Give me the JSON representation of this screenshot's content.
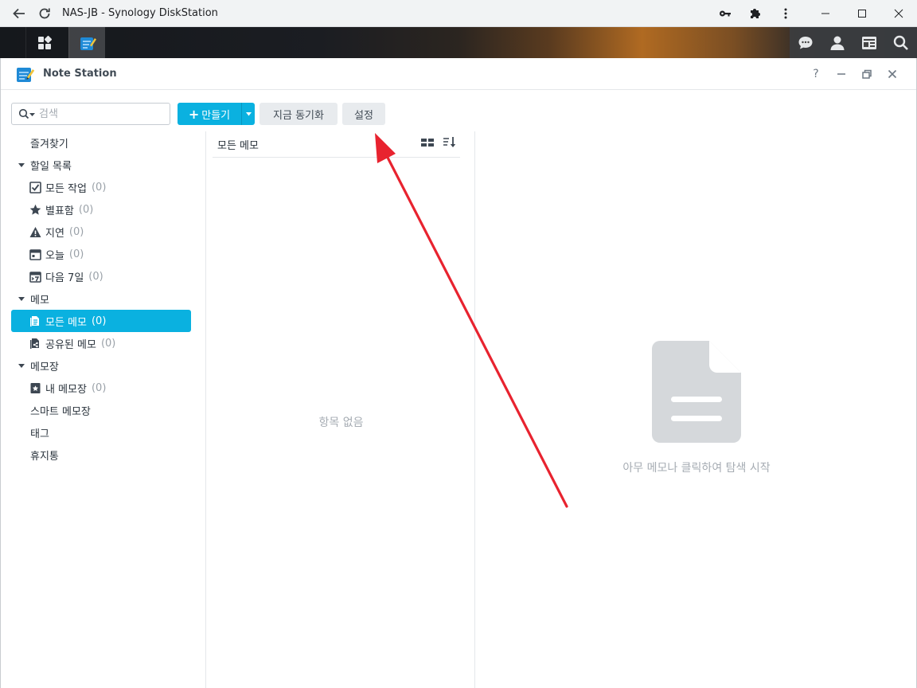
{
  "browser": {
    "title": "NAS-JB - Synology DiskStation"
  },
  "app": {
    "title": "Note Station",
    "help_label": "?"
  },
  "toolbar": {
    "search_placeholder": "검색",
    "create_label": "만들기",
    "sync_label": "지금 동기화",
    "settings_label": "설정"
  },
  "sidebar": {
    "favorites": "즐겨찾기",
    "todo_group": "할일 목록",
    "todo_items": [
      {
        "label": "모든 작업",
        "count": "(0)"
      },
      {
        "label": "별표함",
        "count": "(0)"
      },
      {
        "label": "지연",
        "count": "(0)"
      },
      {
        "label": "오늘",
        "count": "(0)"
      },
      {
        "label": "다음 7일",
        "count": "(0)"
      }
    ],
    "memo_group": "메모",
    "memo_items": [
      {
        "label": "모든 메모",
        "count": "(0)"
      },
      {
        "label": "공유된 메모",
        "count": "(0)"
      }
    ],
    "notebook_group": "메모장",
    "notebook_items": [
      {
        "label": "내 메모장",
        "count": "(0)"
      }
    ],
    "smart_notebook": "스마트 메모장",
    "tags": "태그",
    "trash": "휴지통"
  },
  "notelist": {
    "title": "모든 메모",
    "empty_text": "항목 없음"
  },
  "preview": {
    "empty_text": "아무 메모나 클릭하여 탐색 시작"
  },
  "colors": {
    "accent": "#0ab1e0",
    "arrow": "#e8232f"
  }
}
